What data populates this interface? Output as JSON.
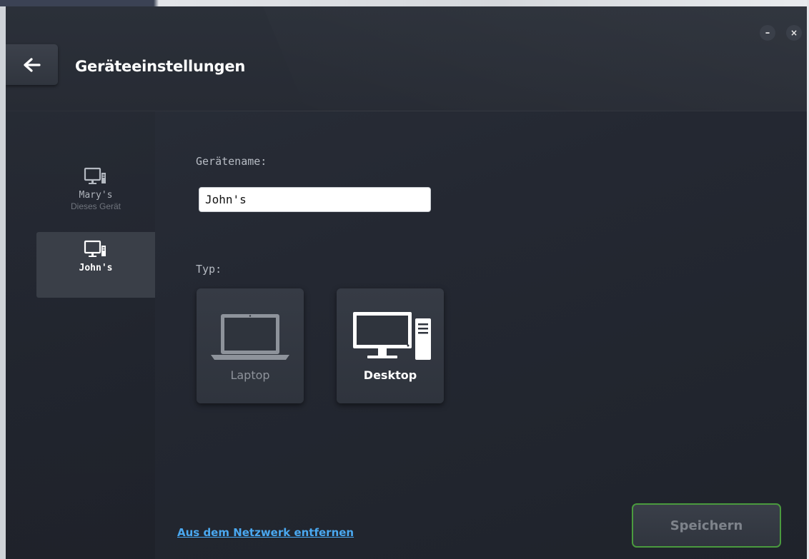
{
  "window": {
    "minimize_label": "–",
    "close_label": "×"
  },
  "header": {
    "back_icon": "arrow-left-icon",
    "title": "Geräteeinstellungen"
  },
  "sidebar": {
    "devices": [
      {
        "name": "Mary's",
        "subtitle": "Dieses Gerät",
        "icon": "desktop-computer-icon",
        "selected": false
      },
      {
        "name": "John's",
        "subtitle": "",
        "icon": "desktop-computer-icon",
        "selected": true
      }
    ]
  },
  "form": {
    "name_label": "Gerätename:",
    "name_value": "John's",
    "type_label": "Typ:",
    "types": [
      {
        "label": "Laptop",
        "icon": "laptop-icon",
        "selected": false
      },
      {
        "label": "Desktop",
        "icon": "desktop-icon",
        "selected": true
      }
    ]
  },
  "footer": {
    "remove_link": "Aus dem Netzwerk entfernen",
    "save_label": "Speichern"
  },
  "colors": {
    "background": "#242832",
    "link": "#4aa8f0",
    "save_border": "#4a9a3e",
    "selected_item": "#3a3f48"
  }
}
